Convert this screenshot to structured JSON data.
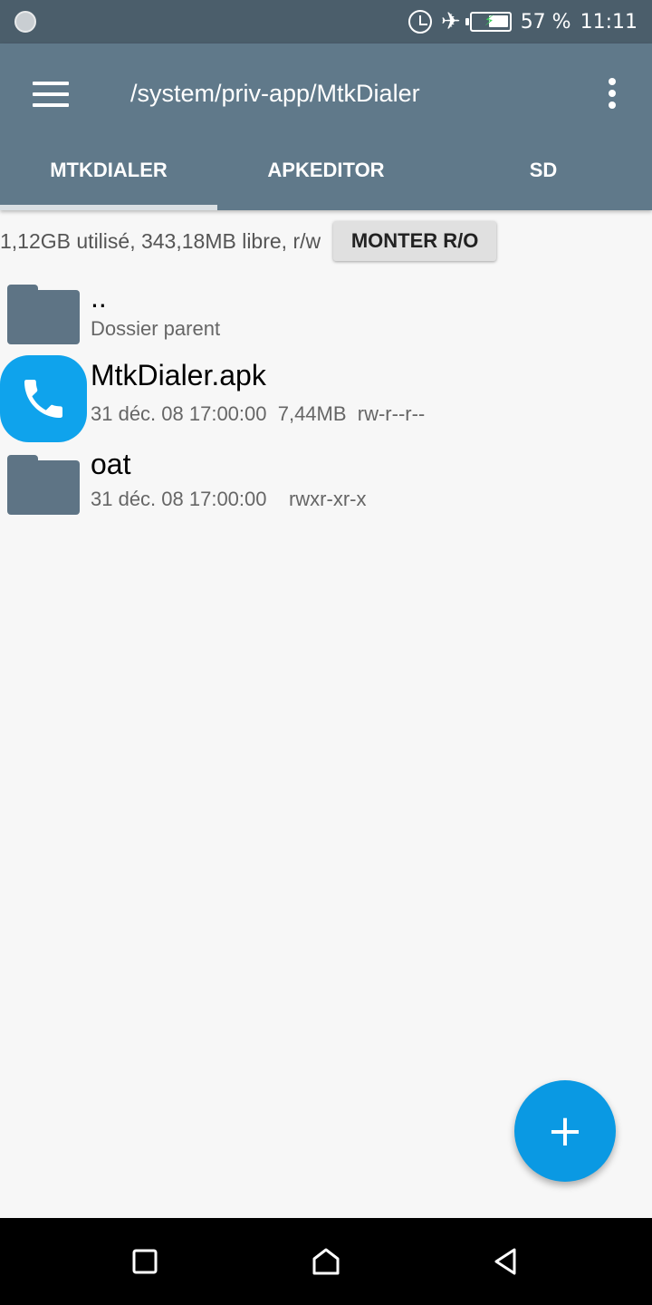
{
  "status_bar": {
    "battery_percent": "57 %",
    "time": "11:11",
    "battery_level": 0.57,
    "icons": [
      "notification-icon",
      "alarm-icon",
      "airplane-mode-icon",
      "battery-charging-icon"
    ]
  },
  "appbar": {
    "title": "/system/priv-app/MtkDialer",
    "menu_icon": "hamburger-menu-icon",
    "overflow_icon": "more-vert-icon"
  },
  "tabs": [
    {
      "label": "MTKDIALER",
      "active": true
    },
    {
      "label": "APKEDITOR",
      "active": false
    },
    {
      "label": "SD",
      "active": false
    }
  ],
  "storage": {
    "info": "1,12GB utilisé, 343,18MB libre, r/w",
    "mount_button": "MONTER R/O"
  },
  "files": [
    {
      "name": "..",
      "subtitle": "Dossier parent",
      "icon": "folder-icon"
    },
    {
      "name": "MtkDialer.apk",
      "subtitle": "31 déc. 08 17:00:00  7,44MB  rw-r--r--",
      "icon": "phone-app-icon"
    },
    {
      "name": "oat",
      "subtitle": "31 déc. 08 17:00:00    rwxr-xr-x",
      "icon": "folder-icon"
    }
  ],
  "fab": {
    "label": "+",
    "icon": "add-icon"
  },
  "navbar": {
    "icons": [
      "recent-apps-icon",
      "home-icon",
      "back-icon"
    ]
  },
  "colors": {
    "status_bar": "#4b5e6b",
    "app_bar": "#60798a",
    "folder": "#5e7485",
    "fab": "#0a99e3",
    "apk_icon": "#0fa3ec"
  }
}
